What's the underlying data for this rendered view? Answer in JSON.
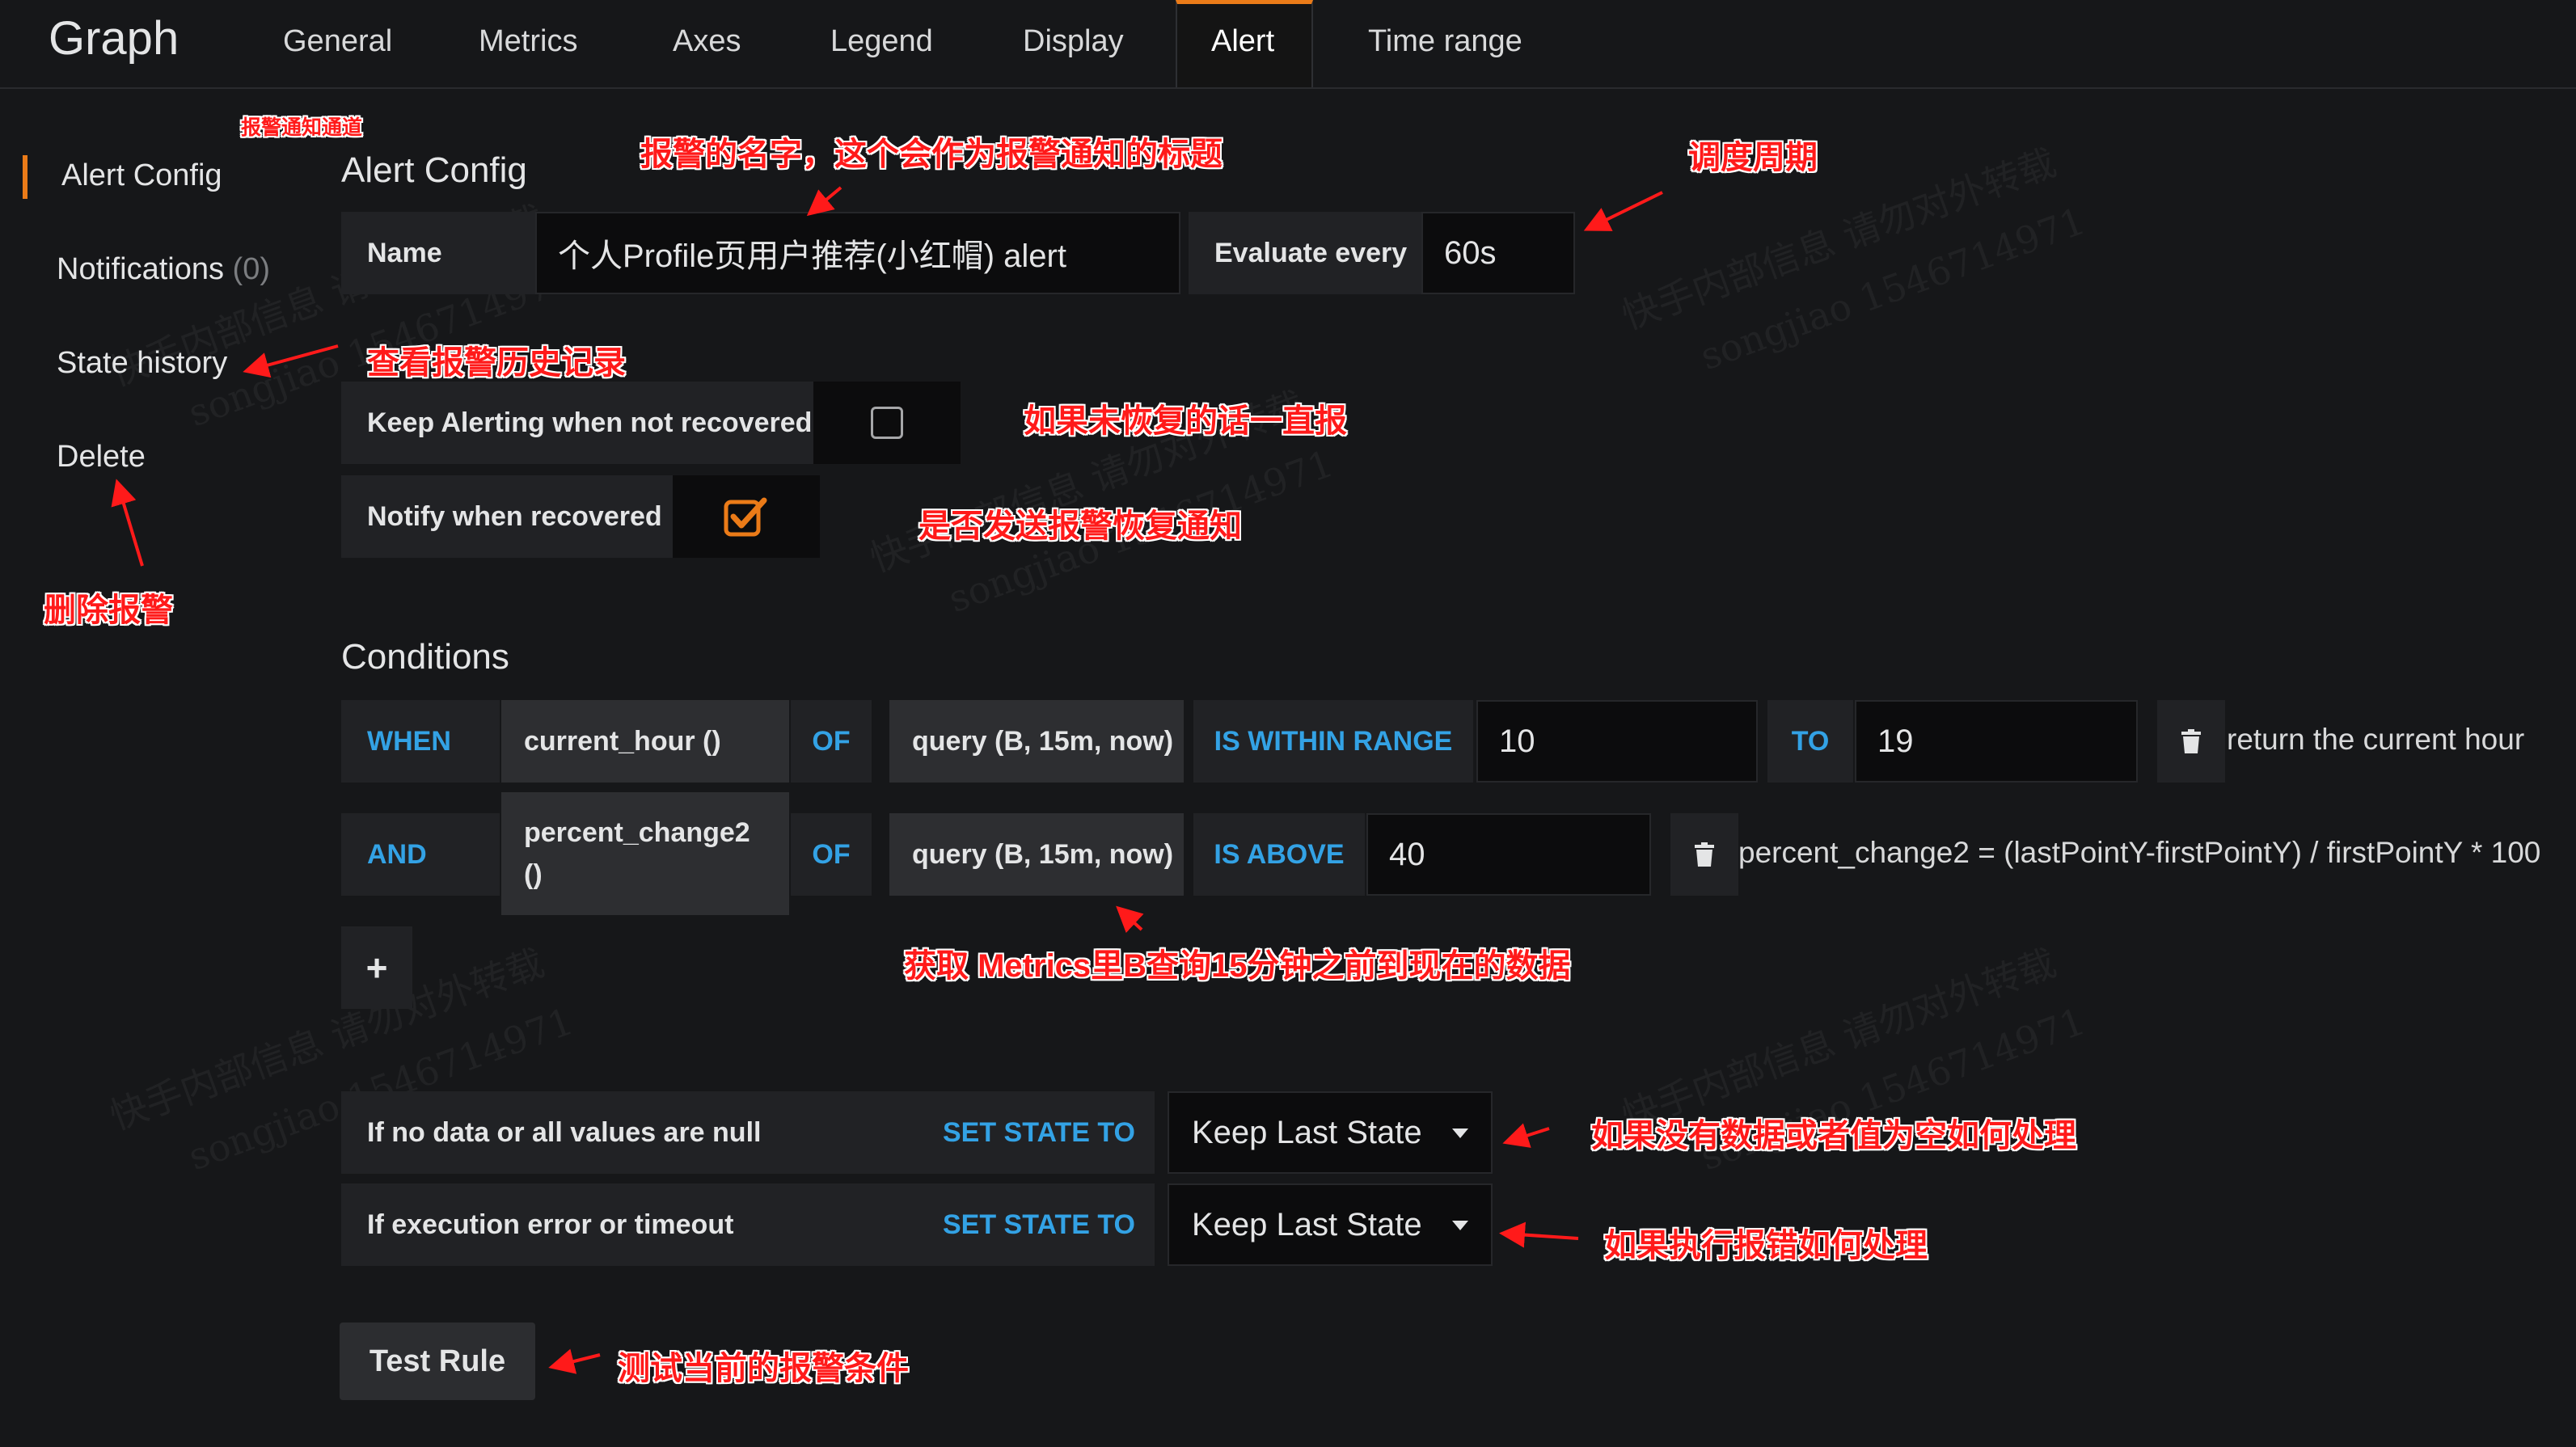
{
  "app": {
    "title": "Graph"
  },
  "tabs": [
    {
      "label": "General"
    },
    {
      "label": "Metrics"
    },
    {
      "label": "Axes"
    },
    {
      "label": "Legend"
    },
    {
      "label": "Display"
    },
    {
      "label": "Alert",
      "active": true
    },
    {
      "label": "Time range"
    }
  ],
  "sidebar": {
    "items": [
      {
        "label": "Alert Config",
        "active": true
      },
      {
        "label": "Notifications",
        "count": "(0)"
      },
      {
        "label": "State history"
      },
      {
        "label": "Delete"
      }
    ]
  },
  "alert_config": {
    "heading": "Alert Config",
    "name_label": "Name",
    "name_value": "个人Profile页用户推荐(小红帽) alert",
    "evaluate_label": "Evaluate every",
    "evaluate_value": "60s",
    "keep_alerting_label": "Keep Alerting when not recovered",
    "keep_alerting_checked": false,
    "notify_label": "Notify when recovered",
    "notify_checked": true
  },
  "conditions": {
    "heading": "Conditions",
    "rows": [
      {
        "op": "WHEN",
        "func": "current_hour ()",
        "of": "OF",
        "query": "query (B, 15m, now)",
        "evaluator": "IS WITHIN RANGE",
        "value1": "10",
        "to": "TO",
        "value2": "19",
        "note": "return the current hour"
      },
      {
        "op": "AND",
        "func_line1": "percent_change2",
        "func_line2": "()",
        "of": "OF",
        "query": "query (B, 15m, now)",
        "evaluator": "IS ABOVE",
        "value1": "40",
        "note": "percent_change2 = (lastPointY-firstPointY) / firstPointY * 100"
      }
    ],
    "add_button": "+"
  },
  "no_data": {
    "label": "If no data or all values are null",
    "set_state": "SET STATE TO",
    "value": "Keep Last State"
  },
  "exec_error": {
    "label": "If execution error or timeout",
    "set_state": "SET STATE TO",
    "value": "Keep Last State"
  },
  "test_rule_button": "Test Rule",
  "annotations": {
    "notify_channel": "报警通知通道",
    "alert_name": "报警的名字，这个会作为报警通知的标题",
    "schedule": "调度周期",
    "history": "查看报警历史记录",
    "keep_alerting": "如果未恢复的话一直报",
    "notify_recovery": "是否发送报警恢复通知",
    "delete": "删除报警",
    "query_desc": "获取 Metrics里B查询15分钟之前到现在的数据",
    "no_data_desc": "如果没有数据或者值为空如何处理",
    "exec_error_desc": "如果执行报错如何处理",
    "test_desc": "测试当前的报警条件"
  },
  "watermark": {
    "line1": "快手内部信息 请勿对外转载",
    "line2": "songjiao 1546714971"
  },
  "colors": {
    "accent": "#eb7b18",
    "keyword": "#33a2e5",
    "annotation": "#ff1a1a",
    "background": "#161719"
  }
}
